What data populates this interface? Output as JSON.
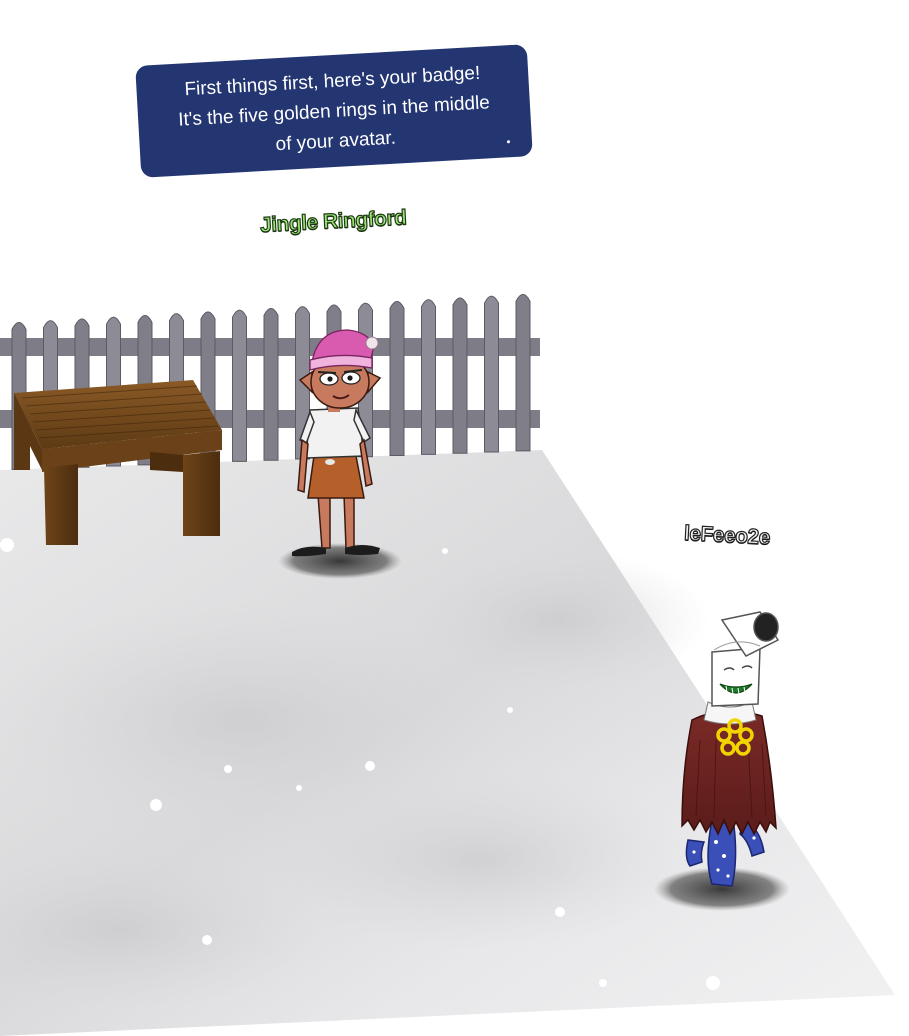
{
  "speech_bubble": {
    "lines": [
      "First things first, here's your badge!",
      "It's the five golden rings in the middle",
      "of your avatar."
    ],
    "background_color": "#243672",
    "text_color": "#ffffff"
  },
  "npc": {
    "name": "Jingle Ringford",
    "name_color": "#9be37a",
    "hat_color": "#d85bb0"
  },
  "player": {
    "name": "leFeeo2e",
    "badge": "five-golden-rings-icon",
    "badge_color": "#f2d400"
  },
  "environment": {
    "ground": "snow",
    "fence_color": "#7e7c86",
    "table_color": "#7a4a1c"
  }
}
